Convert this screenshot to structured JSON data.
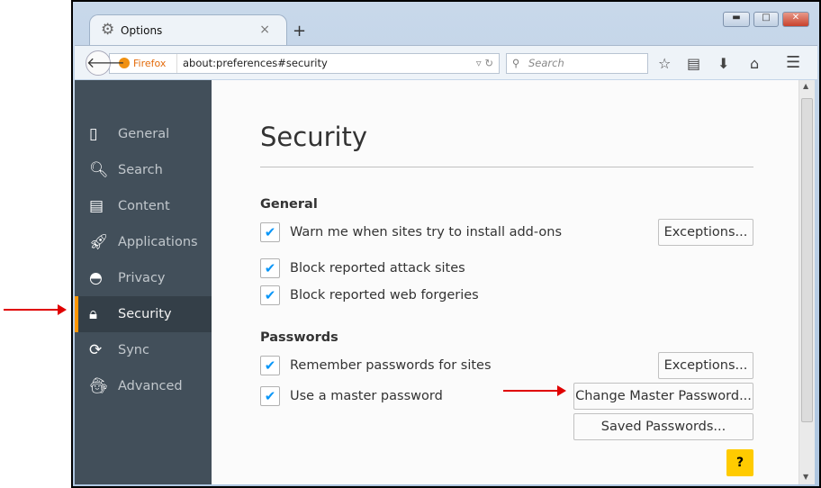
{
  "tab": {
    "title": "Options",
    "close": "×",
    "new_tab": "+"
  },
  "window": {
    "minimize": "▬",
    "maximize": "□",
    "close": "✕"
  },
  "nav": {
    "identity": "Firefox",
    "url": "about:preferences#security",
    "search_placeholder": "Search"
  },
  "sidebar": {
    "items": [
      {
        "label": "General",
        "icon": "▯"
      },
      {
        "label": "Search",
        "icon": "🔍︎"
      },
      {
        "label": "Content",
        "icon": "▤"
      },
      {
        "label": "Applications",
        "icon": "🚀︎"
      },
      {
        "label": "Privacy",
        "icon": "◓"
      },
      {
        "label": "Security",
        "icon": "🔒︎"
      },
      {
        "label": "Sync",
        "icon": "⟳"
      },
      {
        "label": "Advanced",
        "icon": "🧙︎"
      }
    ],
    "selected": "Security"
  },
  "main": {
    "title": "Security",
    "general": {
      "heading": "General",
      "warn_addons": "Warn me when sites try to install add-ons",
      "block_attack": "Block reported attack sites",
      "block_forgeries": "Block reported web forgeries",
      "exceptions": "Exceptions..."
    },
    "passwords": {
      "heading": "Passwords",
      "remember": "Remember passwords for sites",
      "master": "Use a master password",
      "exceptions": "Exceptions...",
      "change_master": "Change Master Password...",
      "saved": "Saved Passwords..."
    },
    "help": "?"
  },
  "colors": {
    "sidebar": "#424f5a",
    "selected_accent": "#ff9500",
    "checkmark": "#0996f8",
    "annotation_arrow": "#e00000"
  }
}
